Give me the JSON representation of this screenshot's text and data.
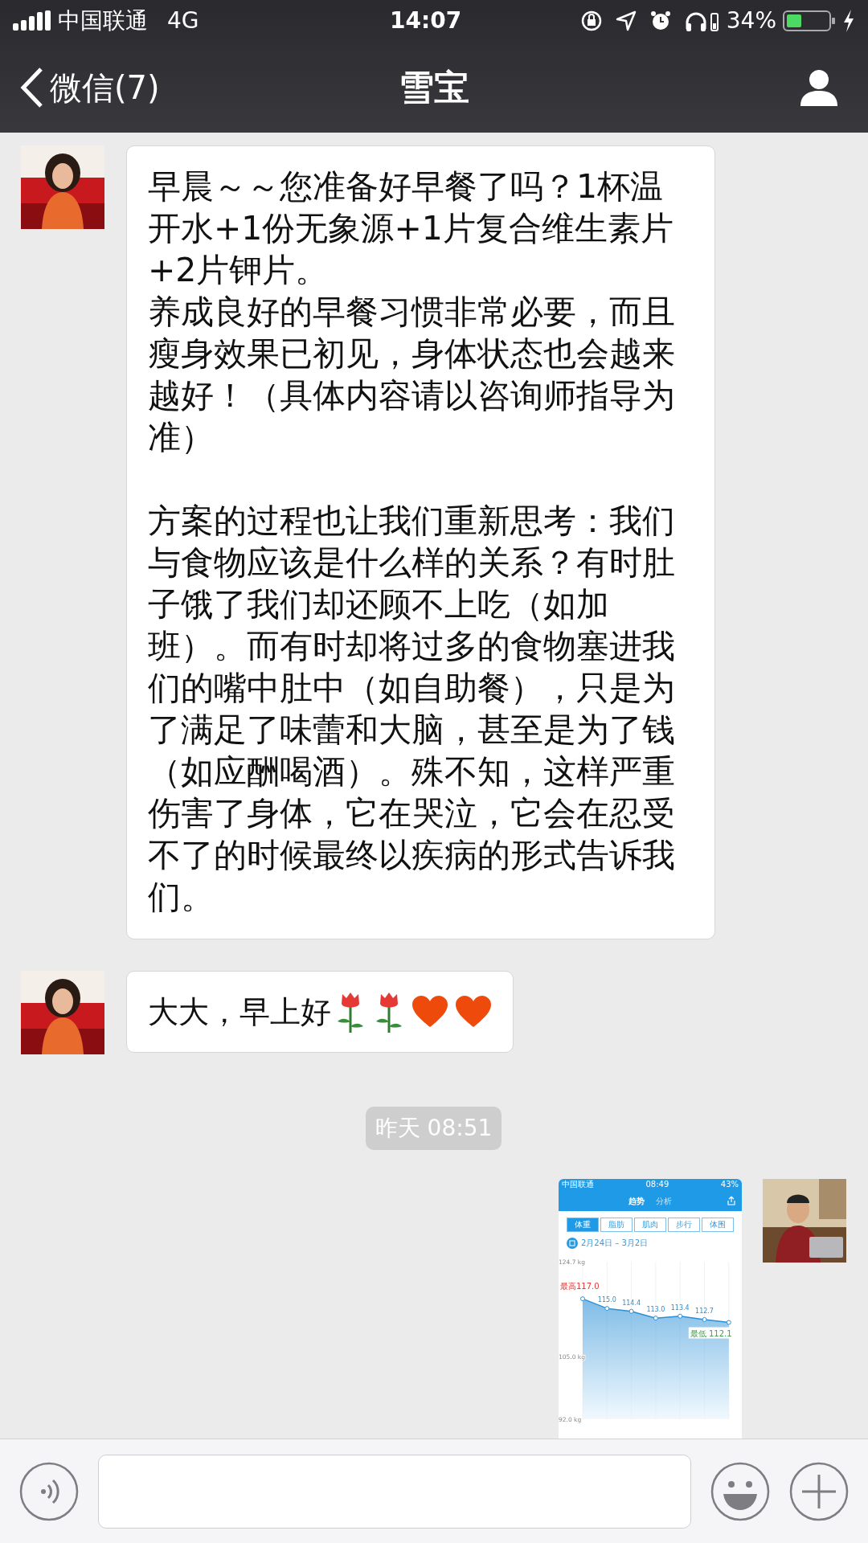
{
  "status_bar": {
    "carrier": "中国联通",
    "network": "4G",
    "time": "14:07",
    "battery": "34%"
  },
  "nav": {
    "back": "微信(7)",
    "title": "雪宝"
  },
  "messages": [
    {
      "kind": "text",
      "outgoing": false,
      "sections": [
        {
          "paragraphs": [
            "早晨～～您准备好早餐了吗？1杯温开水+1份无象源+1片复合维生素片+2片钾片。",
            "养成良好的早餐习惯非常必要，而且瘦身效果已初见，身体状态也会越来越好！（具体内容请以咨询师指导为准）"
          ]
        },
        {
          "paragraphs": [
            "方案的过程也让我们重新思考：我们与食物应该是什么样的关系？有时肚子饿了我们却还顾不上吃（如加班）。而有时却将过多的食物塞进我们的嘴中肚中（如自助餐），只是为了满足了味蕾和大脑，甚至是为了钱（如应酬喝酒）。殊不知，这样严重伤害了身体，它在哭泣，它会在忍受不了的时候最终以疾病的形式告诉我们。"
          ]
        }
      ]
    },
    {
      "kind": "text",
      "outgoing": false,
      "text": "大大，早上好",
      "emoji": [
        {
          "kind": "rose"
        },
        {
          "kind": "rose"
        },
        {
          "kind": "heart"
        },
        {
          "kind": "heart"
        }
      ]
    },
    {
      "kind": "time",
      "text": "昨天 08:51"
    },
    {
      "outgoing": true,
      "screenshot": {
        "status": {
          "carrier": "中国联通",
          "time": "08:49",
          "battery": "43%"
        },
        "tabs": [
          {
            "label": "趋势",
            "selected": true
          },
          {
            "label": "分析",
            "selected": false
          }
        ],
        "segments": [
          {
            "label": "体重",
            "selected": true
          },
          {
            "label": "脂肪",
            "selected": false
          },
          {
            "label": "肌肉",
            "selected": false
          },
          {
            "label": "步行",
            "selected": false
          },
          {
            "label": "体围",
            "selected": false
          }
        ],
        "date_range": "2月24日 – 3月2日",
        "chart_data": {
          "type": "area",
          "categories": [
            null,
            null,
            null,
            null,
            null,
            null,
            null
          ],
          "series": [
            {
              "color": "#2a8fd6",
              "values": [
                117.0,
                115.0,
                114.4,
                113.0,
                113.4,
                112.7,
                112.1
              ]
            }
          ],
          "ylim": [
            92.0,
            124.7
          ],
          "grid": true,
          "yticks": [
            {
              "value": 124.7,
              "label": "124.7 kg"
            },
            {
              "value": 105.0,
              "label": "105.0 kg"
            },
            {
              "value": 92.0,
              "label": "92.0 kg"
            }
          ],
          "value_labels": [
            "最高117.0",
            "115.0",
            "114.4",
            "113.0",
            "113.4",
            "112.7",
            "最低 112.1"
          ]
        }
      }
    }
  ]
}
